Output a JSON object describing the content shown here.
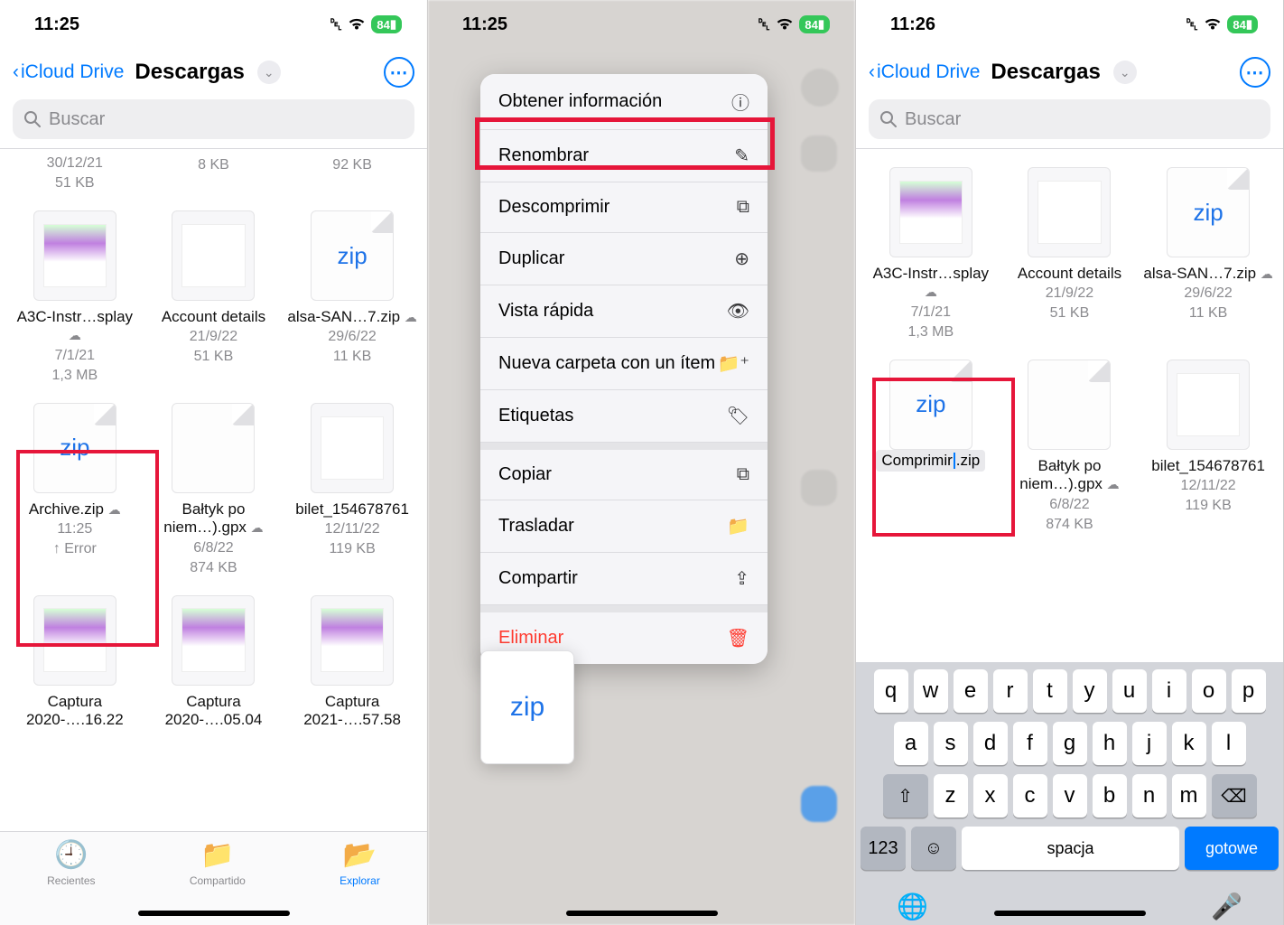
{
  "status": {
    "time1": "11:25",
    "time2": "11:25",
    "time3": "11:26",
    "battery": "84"
  },
  "nav": {
    "back": "iCloud Drive",
    "title": "Descargas"
  },
  "search": {
    "placeholder": "Buscar"
  },
  "s1": {
    "topRow": [
      {
        "date": "30/12/21",
        "size": "51 KB"
      },
      {
        "date": "",
        "size": "8 KB"
      },
      {
        "date": "",
        "size": "92 KB"
      }
    ],
    "files": [
      {
        "name": "A3C-Instr…splay",
        "date": "7/1/21",
        "size": "1,3 MB",
        "cloud": true,
        "kind": "img"
      },
      {
        "name": "Account details",
        "date": "21/9/22",
        "size": "51 KB",
        "cloud": false,
        "kind": "doc"
      },
      {
        "name": "alsa-SAN…7.zip",
        "date": "29/6/22",
        "size": "11 KB",
        "cloud": true,
        "kind": "zip"
      },
      {
        "name": "Archive.zip",
        "date": "11:25",
        "size": "↑ Error",
        "cloud": true,
        "kind": "zip",
        "hl": true
      },
      {
        "name": "Bałtyk po niem…).gpx",
        "date": "6/8/22",
        "size": "874 KB",
        "cloud": true,
        "kind": "blank"
      },
      {
        "name": "bilet_154678761",
        "date": "12/11/22",
        "size": "119 KB",
        "cloud": false,
        "kind": "doc"
      },
      {
        "name": "Captura 2020-….16.22",
        "kind": "img"
      },
      {
        "name": "Captura 2020-….05.04",
        "kind": "img"
      },
      {
        "name": "Captura 2021-….57.58",
        "kind": "img"
      }
    ]
  },
  "tabs": {
    "recent": "Recientes",
    "shared": "Compartido",
    "browse": "Explorar"
  },
  "menu": [
    {
      "label": "Obtener información",
      "icon": "info"
    },
    {
      "label": "Renombrar",
      "icon": "pencil",
      "hl": true
    },
    {
      "label": "Descomprimir",
      "icon": "archive"
    },
    {
      "label": "Duplicar",
      "icon": "dup"
    },
    {
      "label": "Vista rápida",
      "icon": "eye"
    },
    {
      "label": "Nueva carpeta con un ítem",
      "icon": "newfolder"
    },
    {
      "label": "Etiquetas",
      "icon": "tag"
    },
    {
      "sep": true
    },
    {
      "label": "Copiar",
      "icon": "copy"
    },
    {
      "label": "Trasladar",
      "icon": "folder"
    },
    {
      "label": "Compartir",
      "icon": "share"
    },
    {
      "sep": true
    },
    {
      "label": "Eliminar",
      "icon": "trash",
      "danger": true
    }
  ],
  "s3": {
    "files": [
      {
        "name": "A3C-Instr…splay",
        "date": "7/1/21",
        "size": "1,3 MB",
        "cloud": true,
        "kind": "img"
      },
      {
        "name": "Account details",
        "date": "21/9/22",
        "size": "51 KB",
        "cloud": false,
        "kind": "doc"
      },
      {
        "name": "alsa-SAN…7.zip",
        "date": "29/6/22",
        "size": "11 KB",
        "cloud": true,
        "kind": "zip"
      },
      {
        "name": "Comprimir.zip",
        "kind": "zip",
        "editing": true,
        "hl": true
      },
      {
        "name": "Bałtyk po niem…).gpx",
        "date": "6/8/22",
        "size": "874 KB",
        "cloud": true,
        "kind": "blank"
      },
      {
        "name": "bilet_154678761",
        "date": "12/11/22",
        "size": "119 KB",
        "cloud": false,
        "kind": "doc"
      }
    ]
  },
  "kbd": {
    "r1": [
      "q",
      "w",
      "e",
      "r",
      "t",
      "y",
      "u",
      "i",
      "o",
      "p"
    ],
    "r2": [
      "a",
      "s",
      "d",
      "f",
      "g",
      "h",
      "j",
      "k",
      "l"
    ],
    "r3": [
      "z",
      "x",
      "c",
      "v",
      "b",
      "n",
      "m"
    ],
    "num": "123",
    "space": "spacja",
    "done": "gotowe"
  },
  "zip_label": "zip"
}
